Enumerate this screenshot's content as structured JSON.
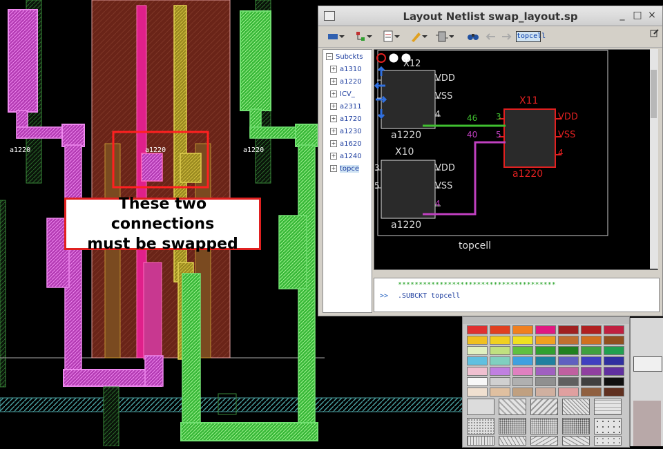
{
  "layout": {
    "cell_labels": [
      "a1220",
      "a1220",
      "a1220"
    ],
    "annotation": "These two connections\nmust be swapped"
  },
  "window": {
    "title": "Layout Netlist swap_layout.sp",
    "buttons": {
      "minimize": "_",
      "maximize": "□",
      "close": "×"
    },
    "toolbar": {
      "cell_box": "topcell",
      "icons": [
        "select-icon",
        "hierarchy-icon",
        "document-icon",
        "highlight-icon",
        "net-icon",
        "find-binoculars-icon",
        "back-arrow-icon",
        "forward-arrow-icon"
      ]
    },
    "tree": {
      "header": "Subckts",
      "items": [
        "a1310",
        "a1220",
        "ICV_",
        "a2311",
        "a1720",
        "a1230",
        "a1620",
        "a1240",
        "topce"
      ]
    },
    "schematic": {
      "partial_cell": "X12",
      "cells": [
        {
          "cell": "a1220",
          "pins": [
            "VDD",
            "VSS",
            "4"
          ]
        },
        {
          "instance": "X10",
          "cell": "a1220",
          "pins": [
            "VDD",
            "VSS",
            "4"
          ],
          "left_pins": [
            "3",
            "5"
          ]
        },
        {
          "instance": "X11",
          "cell": "a1220",
          "pins": [
            "VDD",
            "VSS",
            "4"
          ],
          "left_pins": [
            "3",
            "5"
          ]
        }
      ],
      "nets": [
        "46",
        "40"
      ],
      "top_label": "topcell",
      "colors": {
        "net46": "#40c030",
        "net40": "#c040c0",
        "highlight": "#e02020"
      }
    },
    "console": {
      "stars": "**************************************",
      "prompt": ">>",
      "command": ".SUBCKT topcell"
    }
  },
  "palette": {
    "colors": [
      "#e03030",
      "#e04020",
      "#f08020",
      "#e01880",
      "#a02020",
      "#b02020",
      "#c02040",
      "#f0c020",
      "#f0d020",
      "#f0e020",
      "#f0a020",
      "#c07030",
      "#d07020",
      "#905020",
      "#e0f0c0",
      "#c0e080",
      "#60c040",
      "#30a030",
      "#208020",
      "#40a040",
      "#20a050",
      "#60c0e0",
      "#80d0c0",
      "#40a0e0",
      "#2080a0",
      "#6060c0",
      "#4040c0",
      "#3030a0",
      "#f0c0d0",
      "#c080e0",
      "#e080c0",
      "#a060c0",
      "#c060a0",
      "#9040a0",
      "#6030a0",
      "#f8f8f8",
      "#d0d0d0",
      "#b0b0b0",
      "#909090",
      "#606060",
      "#404040",
      "#101010",
      "#f0e0d0",
      "#e0c0a0",
      "#c0a080",
      "#d0b0a0",
      "#e0a0a0",
      "#906040",
      "#603020"
    ]
  }
}
